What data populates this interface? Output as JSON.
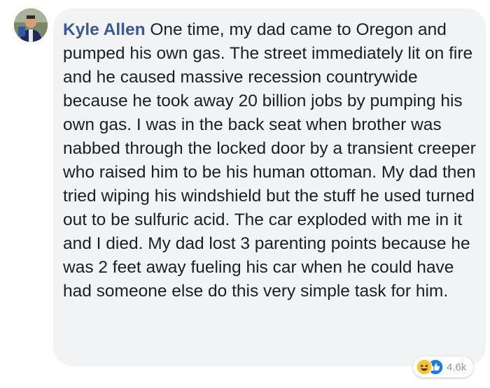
{
  "comment": {
    "author": "Kyle Allen",
    "text": "One time, my dad came to Oregon and pumped his own gas. The street immediately lit on fire and he caused massive recession countrywide because he took away 20 billion jobs by pumping his own gas. I was in the back seat when brother was nabbed through the locked door by a transient creeper who raised him to be his human ottoman. My dad then tried wiping his windshield but the stuff he used turned out to be sulfuric acid. The car exploded with me in it and I died. My dad lost 3 parenting points because he was 2 feet away fueling his car when he could have had someone else do this very simple task for him."
  },
  "reactions": {
    "count": "4.6k",
    "icons": [
      "haha-icon",
      "like-icon"
    ]
  },
  "colors": {
    "bubble_bg": "#f2f3f5",
    "author_link": "#385898",
    "text": "#1c1e21",
    "meta_gray": "#90949c",
    "haha_yellow": "#f7c631",
    "like_blue": "#1877f2"
  }
}
